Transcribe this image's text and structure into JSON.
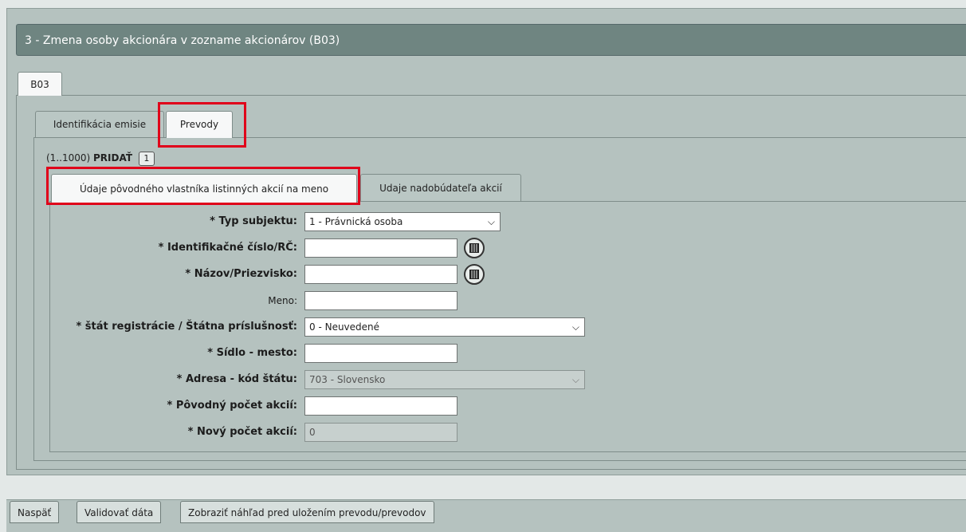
{
  "title": "3 - Zmena osoby akcionára v zozname akcionárov (B03)",
  "tabs_top": [
    "B03"
  ],
  "tabs_sub": [
    "Identifikácia emisie",
    "Prevody"
  ],
  "pridat": {
    "range": "(1..1000)",
    "label": "PRIDAŤ",
    "count": "1"
  },
  "tabs_inner": [
    "Údaje pôvodného vlastníka listinných akcií na meno",
    "Udaje nadobúdateľa akcií"
  ],
  "form": {
    "typ_subjektu": {
      "label": "* Typ subjektu:",
      "value": "1 - Právnická osoba"
    },
    "ico": {
      "label": "* Identifikačné číslo/RČ:",
      "value": ""
    },
    "nazov": {
      "label": "* Názov/Priezvisko:",
      "value": ""
    },
    "meno": {
      "label": "Meno:",
      "value": ""
    },
    "stat": {
      "label": "* štát registrácie / Štátna príslušnosť:",
      "value": "0 - Neuvedené"
    },
    "sidlo": {
      "label": "* Sídlo - mesto:",
      "value": ""
    },
    "adresa": {
      "label": "* Adresa - kód štátu:",
      "value": "703 - Slovensko"
    },
    "povodny_pocet": {
      "label": "* Pôvodný počet akcií:",
      "value": ""
    },
    "novy_pocet": {
      "label": "* Nový počet akcií:",
      "value": "0"
    }
  },
  "buttons": [
    "Naspäť",
    "Validovať dáta",
    "Zobraziť náhľad pred uložením prevodu/prevodov"
  ],
  "icons": {
    "lookup": "book-lookup-icon",
    "dropdown": "chevron-down-icon"
  },
  "colors": {
    "title_bar": "#6f8581",
    "panel": "#b5c2bf",
    "highlight": "#e0001a"
  }
}
